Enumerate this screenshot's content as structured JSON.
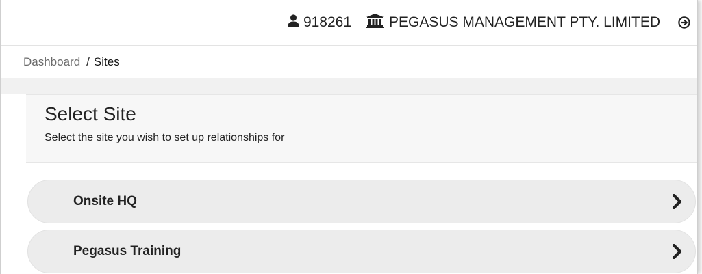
{
  "header": {
    "user_id": "918261",
    "company_name": "PEGASUS MANAGEMENT PTY. LIMITED",
    "icons": {
      "user": "user-icon",
      "company": "bank-icon",
      "logout": "logout-icon"
    }
  },
  "breadcrumb": {
    "home": "Dashboard",
    "separator": "/",
    "current": "Sites"
  },
  "panel": {
    "title": "Select Site",
    "subtitle": "Select the site you wish to set up relationships for"
  },
  "sites": [
    {
      "name": "Onsite HQ"
    },
    {
      "name": "Pegasus Training"
    }
  ],
  "colors": {
    "list_item_bg": "#ececec",
    "panel_bg": "#f7f7f7",
    "band_bg": "#f1f1f1"
  }
}
